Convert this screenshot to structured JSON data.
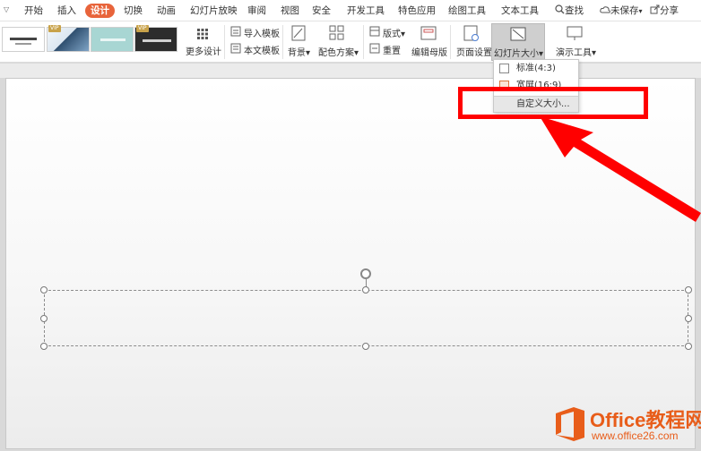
{
  "menu": {
    "caret": "▽",
    "tabs": [
      "开始",
      "插入",
      "设计",
      "切换",
      "动画",
      "幻灯片放映",
      "审阅",
      "视图",
      "安全",
      "开发工具",
      "特色应用",
      "绘图工具",
      "文本工具"
    ],
    "active_tab": "设计",
    "search_label": "查找",
    "unsaved_label": "未保存",
    "share_label": "分享"
  },
  "ribbon": {
    "vip_badge": "VIP",
    "more_designs": "更多设计",
    "import_template": "导入模板",
    "text_template": "本文模板",
    "background": "背景",
    "color_scheme": "配色方案",
    "layout": "版式",
    "reset": "重置",
    "edit_master": "编辑母版",
    "page_setup": "页面设置",
    "slide_size": "幻灯片大小",
    "present_tools": "演示工具",
    "dropdown_caret": "▾"
  },
  "dropdown": {
    "standard": "标准(4:3)",
    "widescreen": "宽屏(16:9)",
    "custom_size": "自定义大小..."
  },
  "watermark": {
    "title": "Office教程网",
    "url": "www.office26.com"
  },
  "colors": {
    "accent": "#e8643b",
    "highlight": "#ff0000",
    "watermark": "#e85d1a"
  }
}
